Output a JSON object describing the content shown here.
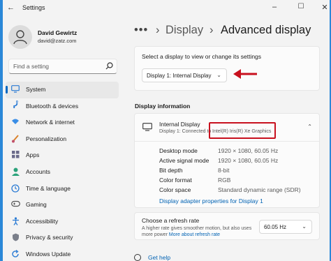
{
  "window": {
    "title": "Settings",
    "back_icon": "back-arrow-icon",
    "controls": [
      "minimize",
      "maximize",
      "close"
    ]
  },
  "profile": {
    "name": "David Gewirtz",
    "email": "david@zatz.com"
  },
  "search": {
    "placeholder": "Find a setting"
  },
  "sidebar": {
    "items": [
      {
        "label": "System",
        "icon": "display-icon",
        "active": true
      },
      {
        "label": "Bluetooth & devices",
        "icon": "bluetooth-icon"
      },
      {
        "label": "Network & internet",
        "icon": "wifi-icon"
      },
      {
        "label": "Personalization",
        "icon": "brush-icon"
      },
      {
        "label": "Apps",
        "icon": "apps-icon"
      },
      {
        "label": "Accounts",
        "icon": "person-icon"
      },
      {
        "label": "Time & language",
        "icon": "globe-clock-icon"
      },
      {
        "label": "Gaming",
        "icon": "gamepad-icon"
      },
      {
        "label": "Accessibility",
        "icon": "accessibility-icon"
      },
      {
        "label": "Privacy & security",
        "icon": "shield-icon"
      },
      {
        "label": "Windows Update",
        "icon": "update-icon"
      }
    ]
  },
  "breadcrumb": {
    "overflow": "•••",
    "separator": "›",
    "parent": "Display",
    "current": "Advanced display"
  },
  "selector": {
    "prompt": "Select a display to view or change its settings",
    "value": "Display 1: Internal Display"
  },
  "display_info": {
    "section_title": "Display information",
    "display_name": "Internal Display",
    "subtitle_prefix": "Display 1: Connected to",
    "gpu": "Intel(R) Iris(R) Xe Graphics",
    "rows": [
      {
        "key": "Desktop mode",
        "value": "1920 × 1080, 60.05 Hz"
      },
      {
        "key": "Active signal mode",
        "value": "1920 × 1080, 60.05 Hz"
      },
      {
        "key": "Bit depth",
        "value": "8-bit"
      },
      {
        "key": "Color format",
        "value": "RGB"
      },
      {
        "key": "Color space",
        "value": "Standard dynamic range (SDR)"
      }
    ],
    "adapter_link": "Display adapter properties for Display 1"
  },
  "refresh": {
    "title": "Choose a refresh rate",
    "desc": "A higher rate gives smoother motion, but also uses more power",
    "link": "More about refresh rate",
    "value": "60.05 Hz"
  },
  "help": {
    "label": "Get help"
  },
  "colors": {
    "accent": "#0067c0",
    "highlight_red": "#c8101e",
    "link": "#0062b3"
  }
}
